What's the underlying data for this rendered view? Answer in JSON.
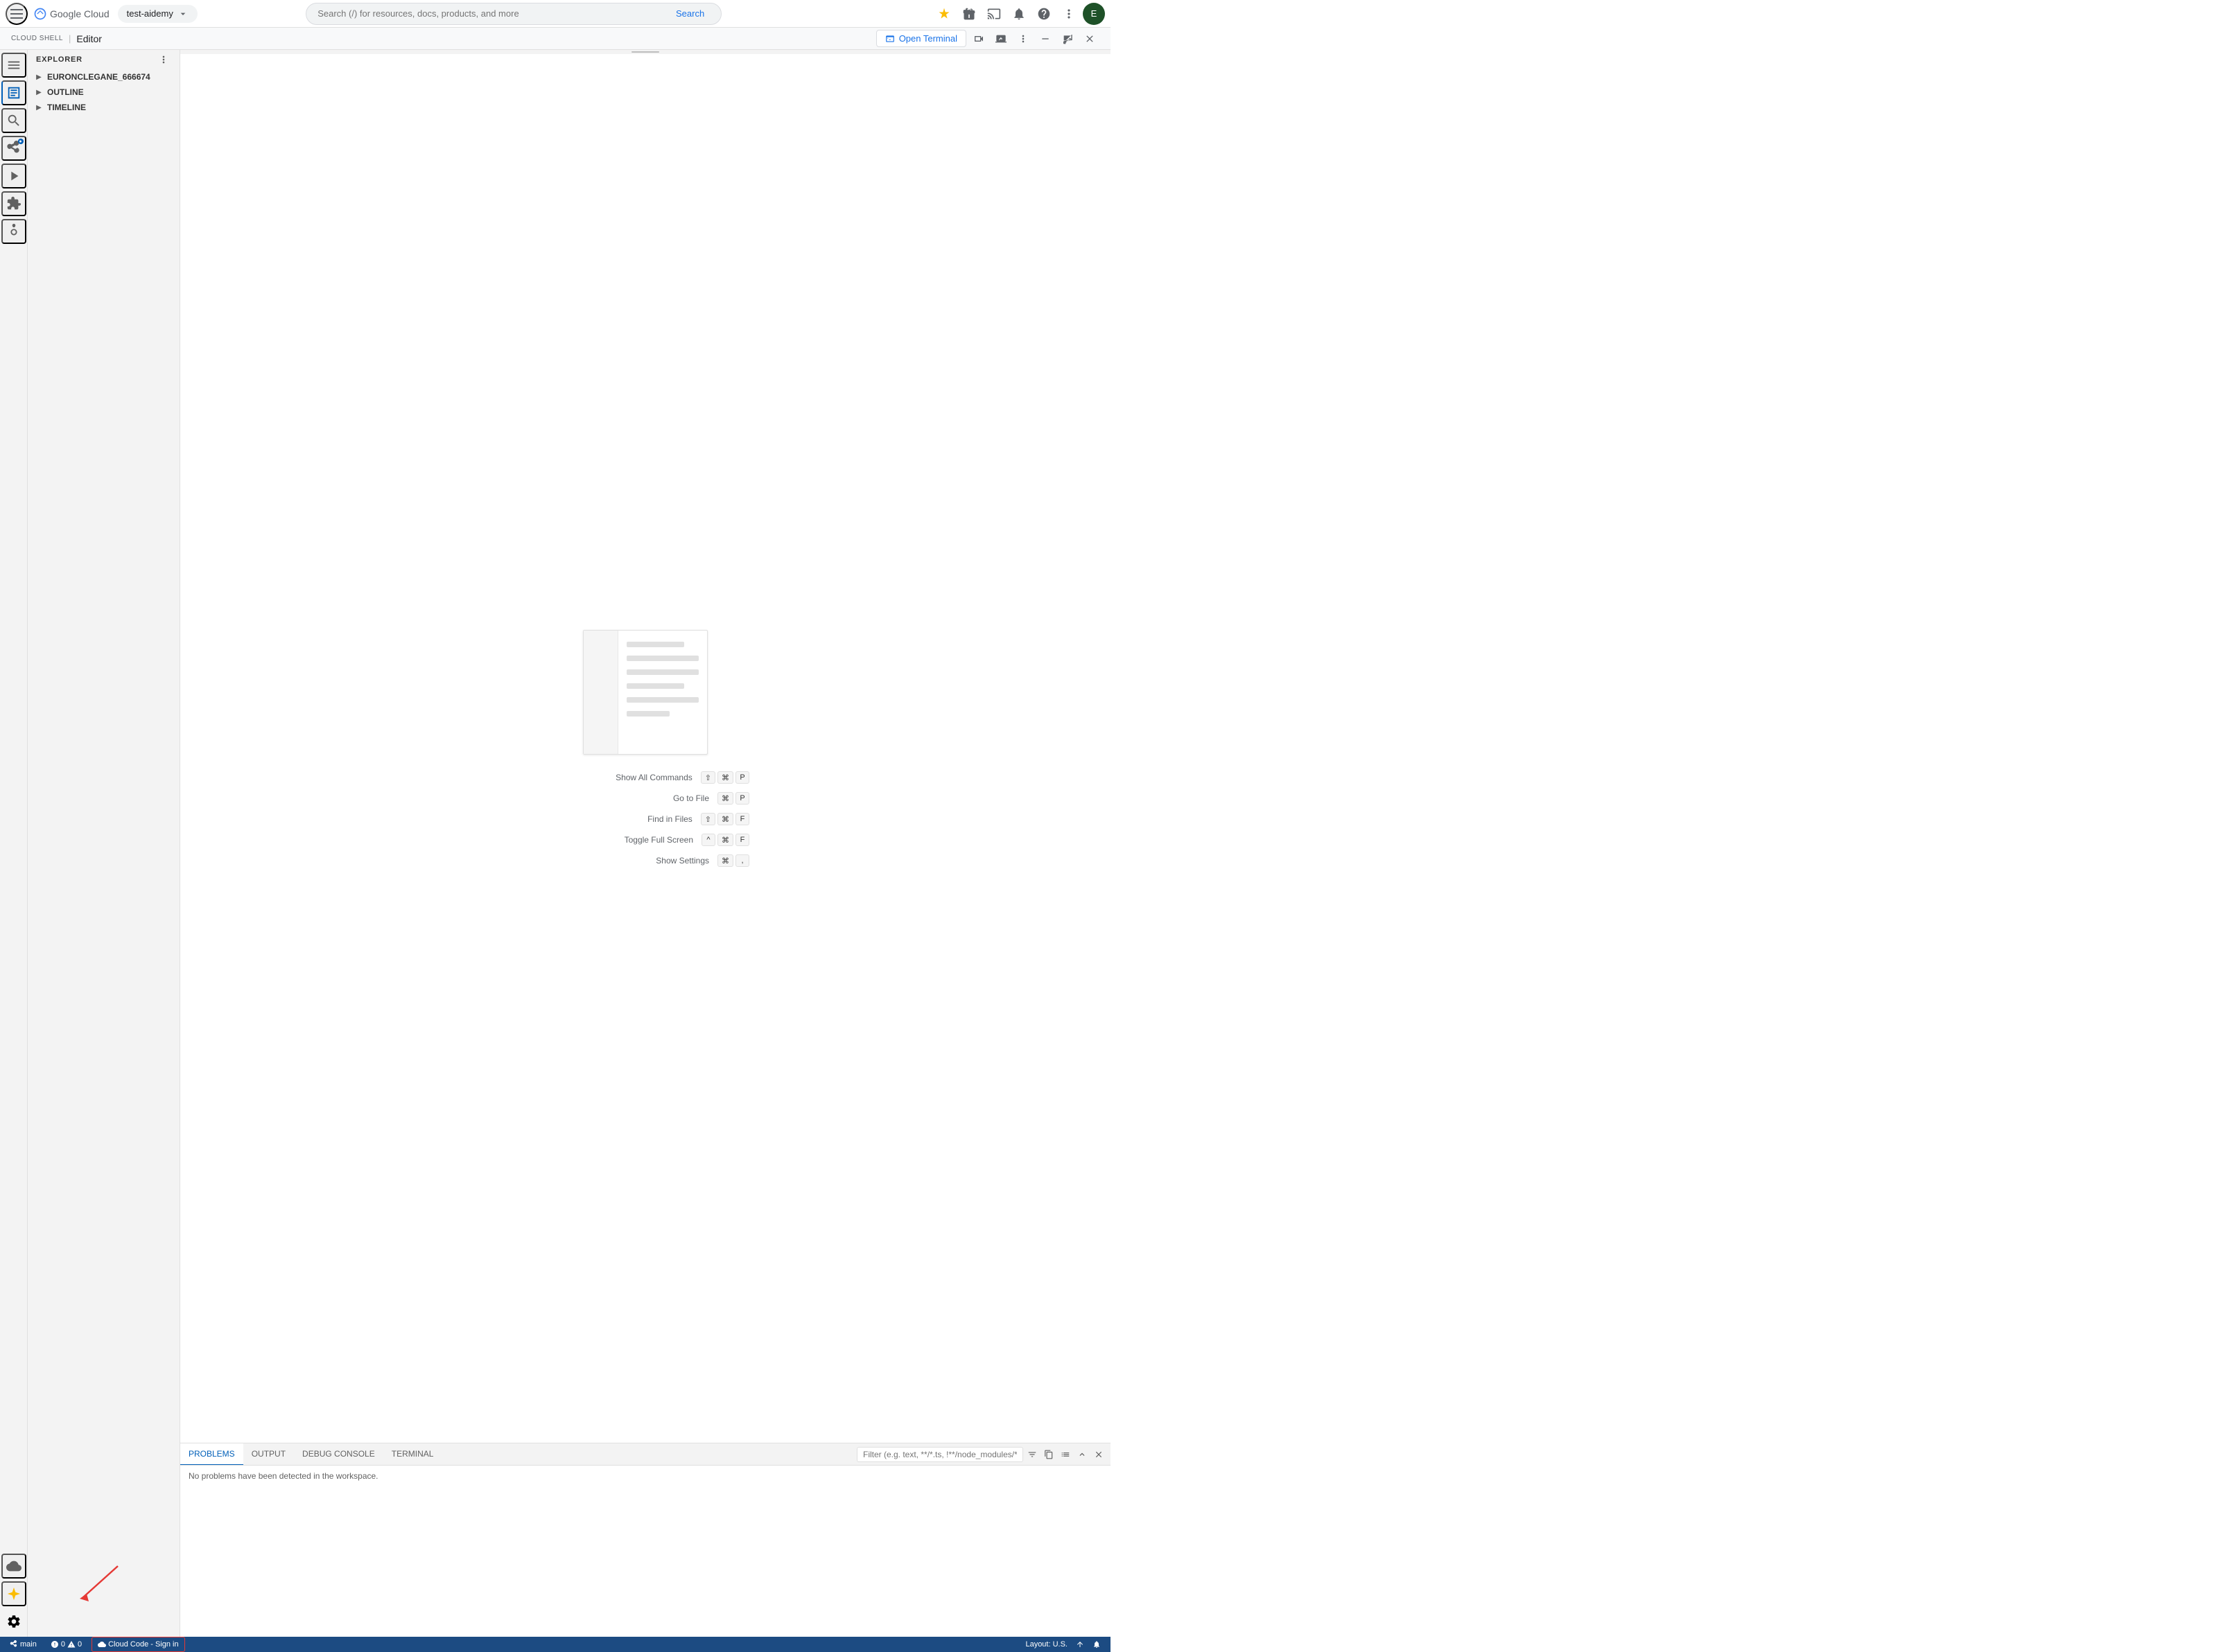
{
  "header": {
    "hamburger_label": "Menu",
    "logo": "Google Cloud",
    "project": "test-aidemy",
    "search_placeholder": "Search (/) for resources, docs, products, and more",
    "search_btn": "Search",
    "icons": [
      "star",
      "gift",
      "cast",
      "bell",
      "help",
      "more_vert"
    ],
    "avatar": "E"
  },
  "editor_header": {
    "cloud_shell_label": "CLOUD SHELL",
    "editor_title": "Editor",
    "open_terminal_btn": "Open Terminal",
    "icons": [
      "webcam",
      "screen",
      "more_vert",
      "minimize",
      "fullscreen",
      "close"
    ]
  },
  "sidebar": {
    "title": "EXPLORER",
    "items": [
      {
        "label": "EURONCLEGANE_666674",
        "expanded": true
      },
      {
        "label": "OUTLINE",
        "expanded": false
      },
      {
        "label": "TIMELINE",
        "expanded": false
      }
    ]
  },
  "welcome": {
    "commands": [
      {
        "label": "Show All Commands",
        "keys": [
          "⇧",
          "⌘",
          "P"
        ]
      },
      {
        "label": "Go to File",
        "keys": [
          "⌘",
          "P"
        ]
      },
      {
        "label": "Find in Files",
        "keys": [
          "⇧",
          "⌘",
          "F"
        ]
      },
      {
        "label": "Toggle Full Screen",
        "keys": [
          "^",
          "⌘",
          "F"
        ]
      },
      {
        "label": "Show Settings",
        "keys": [
          "⌘",
          ","
        ]
      }
    ]
  },
  "panel": {
    "tabs": [
      {
        "label": "PROBLEMS",
        "active": true
      },
      {
        "label": "OUTPUT"
      },
      {
        "label": "DEBUG CONSOLE"
      },
      {
        "label": "TERMINAL"
      }
    ],
    "filter_placeholder": "Filter (e.g. text, **/*.ts, !**/node_modules/**)",
    "no_problems_msg": "No problems have been detected in the workspace."
  },
  "status_bar": {
    "branch": "main",
    "errors": "0",
    "warnings": "0",
    "cloud_code_label": "Cloud Code - Sign in",
    "layout": "Layout: U.S.",
    "icons_right": [
      "arrow_up",
      "bell"
    ]
  }
}
